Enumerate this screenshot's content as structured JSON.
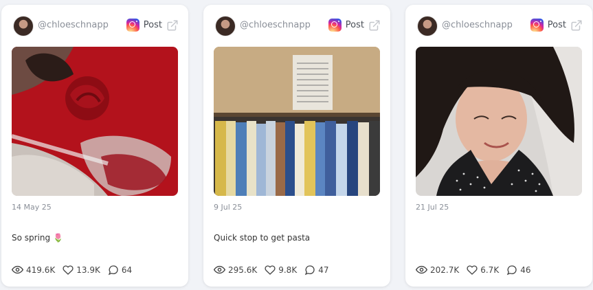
{
  "cards": [
    {
      "handle": "@chloeschnapp",
      "post_label": "Post",
      "date": "14 May 25",
      "caption": "So spring 🌷",
      "views": "419.6K",
      "likes": "13.9K",
      "comments": "64"
    },
    {
      "handle": "@chloeschnapp",
      "post_label": "Post",
      "date": "9 Jul 25",
      "caption": "Quick stop to get pasta",
      "views": "295.6K",
      "likes": "9.8K",
      "comments": "47"
    },
    {
      "handle": "@chloeschnapp",
      "post_label": "Post",
      "date": "21 Jul 25",
      "caption": "",
      "views": "202.7K",
      "likes": "6.7K",
      "comments": "46"
    }
  ],
  "icons": {
    "brand": "instagram-icon",
    "external": "external-link-icon",
    "views": "eye-icon",
    "likes": "heart-icon",
    "comments": "comment-icon"
  },
  "colors": {
    "background": "#f1f3f7",
    "card": "#ffffff",
    "muted_text": "#8a8f98"
  }
}
